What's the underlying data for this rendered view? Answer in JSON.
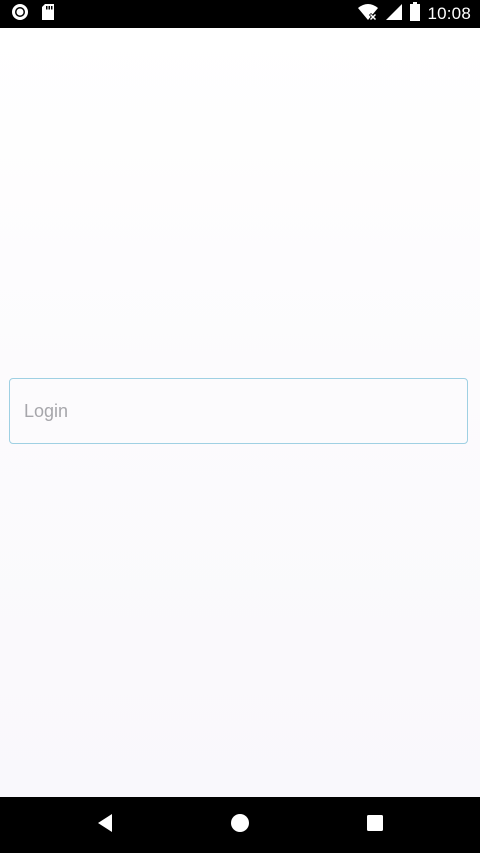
{
  "status_bar": {
    "time": "10:08",
    "icons": [
      "record-icon",
      "sd-card-icon",
      "wifi-no-internet-icon",
      "cell-signal-icon",
      "battery-icon"
    ]
  },
  "login_form": {
    "login_placeholder": "Login",
    "login_value": ""
  },
  "nav_bar": {
    "icons": [
      "back-icon",
      "home-icon",
      "recents-icon"
    ]
  },
  "colors": {
    "field_border": "#9fd0e3",
    "placeholder": "#a6a6ab",
    "system_bars": "#000000"
  }
}
